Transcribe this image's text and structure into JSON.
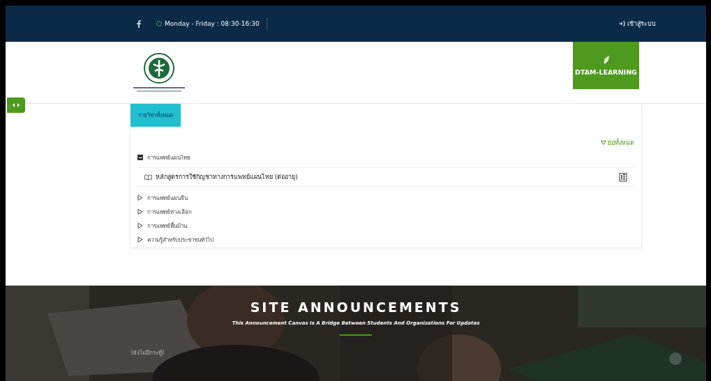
{
  "topbar": {
    "hours": "Monday - Friday : 08:30-16:30",
    "login": "เข้าสู่ระบบ"
  },
  "brand": {
    "label": "DTAM-LEARNING"
  },
  "courses": {
    "tab": {
      "label": "รายวิชาทั้งหมด",
      "selected": true
    },
    "collapse_all": "ย่อทั้งหมด",
    "categories": [
      {
        "name": "การแพทย์แผนไทย",
        "expanded": true,
        "children": [
          {
            "name": "หลักสูตรการใช้กัญชาทางการแพทย์แผนไทย (ต่ออายุ)"
          }
        ]
      },
      {
        "name": "การแพทย์แผนจีน",
        "expanded": false
      },
      {
        "name": "การแพทย์ทางเลือก",
        "expanded": false
      },
      {
        "name": "การแพทย์พื้นบ้าน",
        "expanded": false
      },
      {
        "name": "ความรู้สำหรับประชาชนทั่วไป",
        "expanded": false
      }
    ]
  },
  "announcements": {
    "title": "SITE ANNOUNCEMENTS",
    "subtitle": "This Announcement Canvas Is A Bridge Between Students And Organizations For Updates",
    "empty": "(ยังไม่มีกระทู้)"
  }
}
